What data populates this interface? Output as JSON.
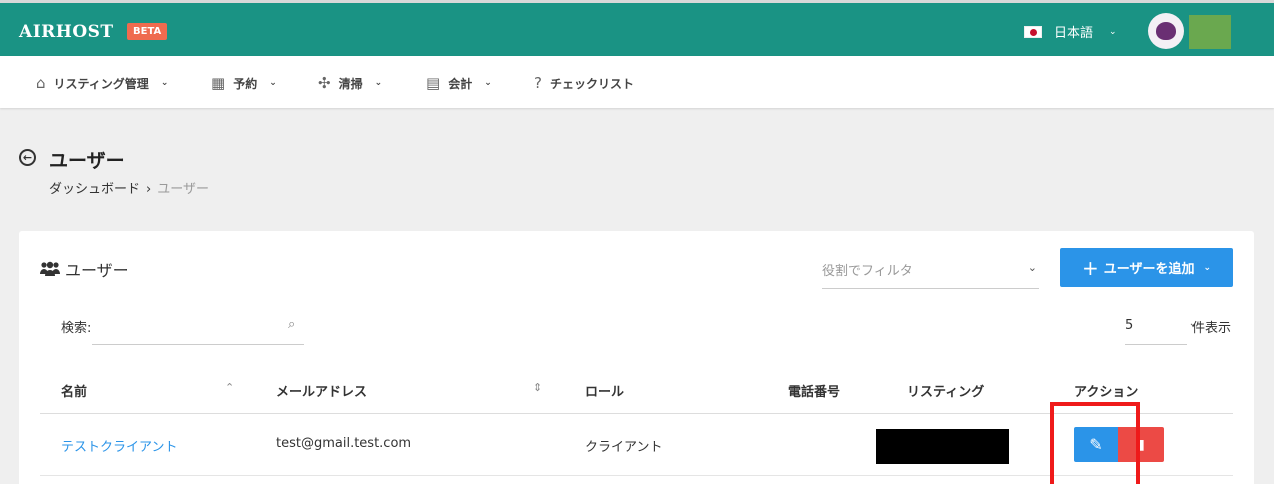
{
  "brand": {
    "logo": "AIRHOST",
    "badge": "BETA"
  },
  "header": {
    "language": "日本語"
  },
  "nav": [
    {
      "label": "リスティング管理",
      "icon": "home-icon"
    },
    {
      "label": "予約",
      "icon": "calendar-icon"
    },
    {
      "label": "清掃",
      "icon": "puzzle-icon"
    },
    {
      "label": "会計",
      "icon": "calculator-icon"
    },
    {
      "label": "チェックリスト",
      "icon": "question-circle-icon"
    }
  ],
  "page": {
    "title": "ユーザー",
    "breadcrumb": [
      "ダッシュボード",
      "ユーザー"
    ]
  },
  "card": {
    "title": "ユーザー",
    "role_filter_placeholder": "役割でフィルタ",
    "add_button": "ユーザーを追加",
    "search_label": "検索:",
    "per_page": "5",
    "per_page_label": "件表示"
  },
  "table": {
    "columns": [
      "名前",
      "メールアドレス",
      "ロール",
      "電話番号",
      "リスティング",
      "アクション"
    ],
    "rows": [
      {
        "name": "テストクライアント",
        "email": "test@gmail.test.com",
        "role": "クライアント",
        "phone": ""
      }
    ]
  },
  "colors": {
    "header_bg": "#1a9384",
    "primary": "#2b94e8",
    "danger": "#ec4a45",
    "highlight": "#ef1a1a"
  }
}
